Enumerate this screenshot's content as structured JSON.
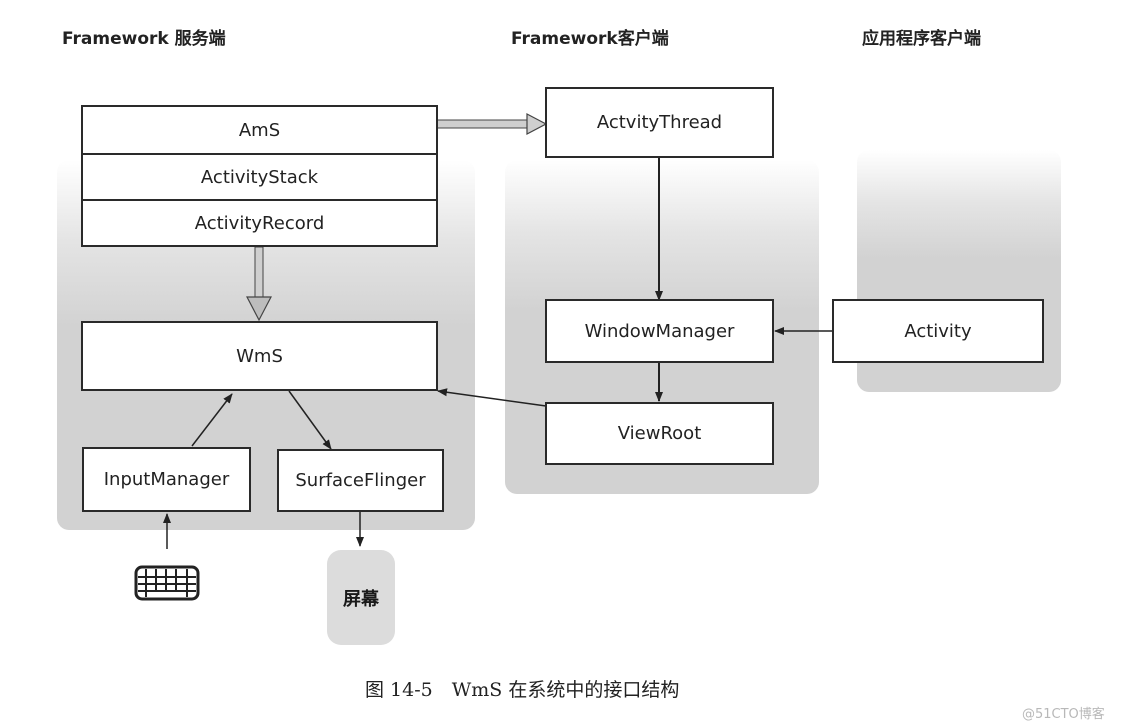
{
  "columns": {
    "server": "Framework 服务端",
    "client": "Framework客户端",
    "app": "应用程序客户端"
  },
  "nodes": {
    "ams": "AmS",
    "activity_stack": "ActivityStack",
    "activity_record": "ActivityRecord",
    "wms": "WmS",
    "input_manager": "InputManager",
    "surface_flinger": "SurfaceFlinger",
    "activity_thread": "ActvityThread",
    "window_manager": "WindowManager",
    "view_root": "ViewRoot",
    "activity": "Activity",
    "screen": "屏幕"
  },
  "icons": {
    "keyboard": "keyboard-icon"
  },
  "edges": [
    {
      "from": "AmS",
      "to": "ActvityThread",
      "style": "hollow-thick"
    },
    {
      "from": "ActivityRecord",
      "to": "WmS",
      "style": "hollow-thick"
    },
    {
      "from": "ActvityThread",
      "to": "WindowManager",
      "style": "solid"
    },
    {
      "from": "WindowManager",
      "to": "ViewRoot",
      "style": "solid"
    },
    {
      "from": "Activity",
      "to": "WindowManager",
      "style": "solid"
    },
    {
      "from": "ViewRoot",
      "to": "WmS",
      "style": "solid"
    },
    {
      "from": "InputManager",
      "to": "WmS",
      "style": "solid"
    },
    {
      "from": "WmS",
      "to": "SurfaceFlinger",
      "style": "solid"
    },
    {
      "from": "SurfaceFlinger",
      "to": "屏幕",
      "style": "solid"
    },
    {
      "from": "keyboard",
      "to": "InputManager",
      "style": "solid"
    }
  ],
  "caption": "图 14-5　WmS 在系统中的接口结构",
  "watermark": "@51CTO博客"
}
